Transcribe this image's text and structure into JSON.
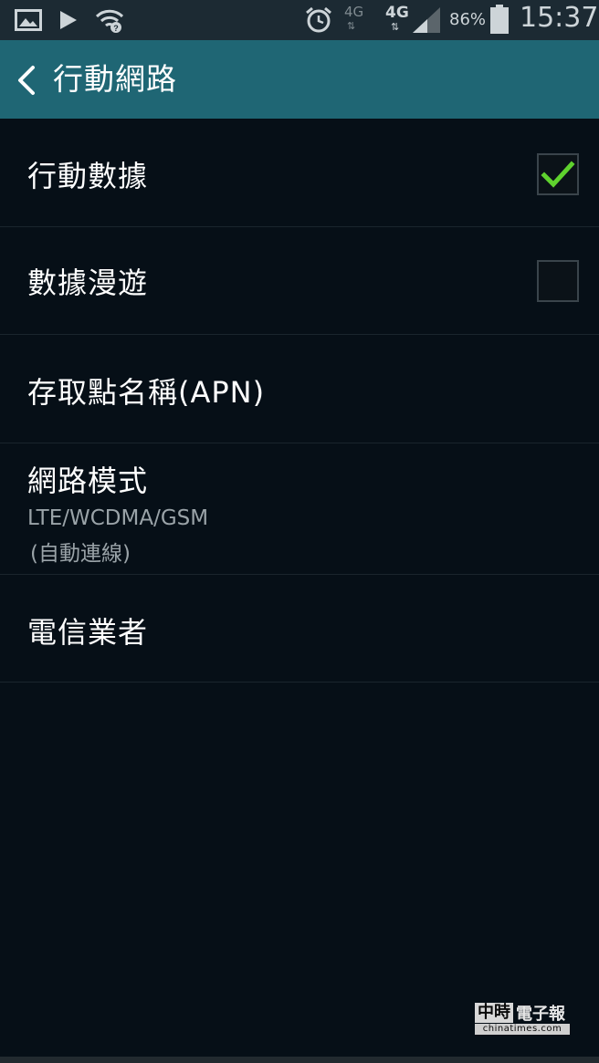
{
  "status_bar": {
    "net1": "4G",
    "net2": "4G",
    "battery": "86%",
    "time": "15:37",
    "icons": [
      "gallery-icon",
      "play-icon",
      "wifi-icon",
      "alarm-icon",
      "signal-icon",
      "battery-icon"
    ]
  },
  "header": {
    "title": "行動網路",
    "back_icon": "chevron-left-icon",
    "color": "#1f6674"
  },
  "settings": {
    "mobile_data": {
      "label": "行動數據",
      "checked": true
    },
    "data_roaming": {
      "label": "數據漫遊",
      "checked": false
    },
    "apn": {
      "label": "存取點名稱(APN)"
    },
    "network_mode": {
      "label": "網路模式",
      "value": "LTE/WCDMA/GSM",
      "detail": "(自動連線)"
    },
    "operators": {
      "label": "電信業者"
    }
  },
  "watermark": {
    "brand": "中時",
    "name": "電子報",
    "url": "chinatimes.com"
  },
  "colors": {
    "background": "#060f17",
    "check": "#5fd22e",
    "divider": "#1a252d"
  }
}
